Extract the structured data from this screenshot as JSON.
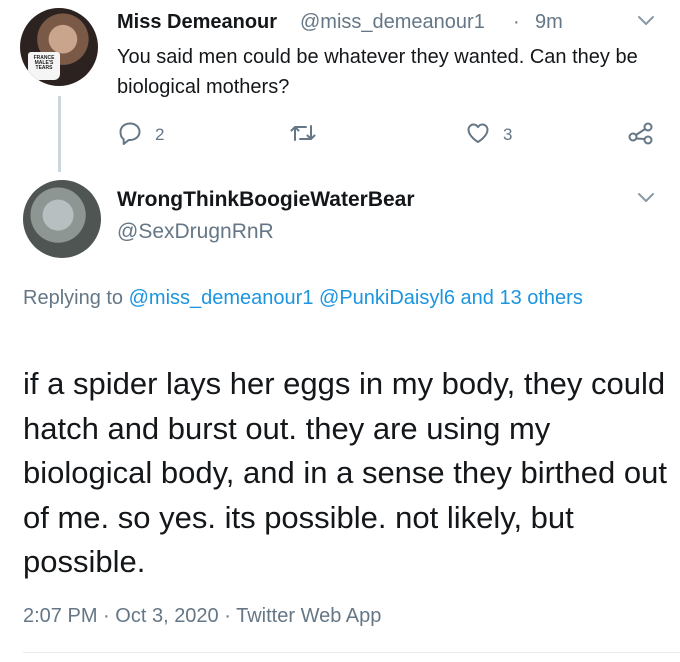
{
  "tweet1": {
    "display_name": "Miss Demeanour",
    "handle": "@miss_demeanour1",
    "separator": "·",
    "time": "9m",
    "text": "You said men could be whatever they wanted. Can they be biological mothers?",
    "avatar_mug_text": "FRANCE MALE'S TEARS",
    "reply_count": "2",
    "retweet_count": "",
    "like_count": "3"
  },
  "tweet2": {
    "display_name": "WrongThinkBoogieWaterBear",
    "handle": "@SexDrugnRnR",
    "replying_prefix": "Replying to",
    "mentions": [
      "@miss_demeanour1",
      "@PunkiDaisyl6",
      "and 13 others"
    ],
    "text": "if a spider lays her eggs in my body, they could hatch and burst out. they are using my biological body, and in a sense they birthed out of me. so yes. its possible. not likely, but possible.",
    "time": "2:07 PM",
    "date": "Oct 3, 2020",
    "source": "Twitter Web App",
    "separator": "·"
  },
  "icons": {
    "more": "chevron-down-icon",
    "reply": "reply-icon",
    "retweet": "retweet-icon",
    "like": "heart-icon",
    "share": "share-icon"
  },
  "colors": {
    "text": "#14171a",
    "secondary": "#657786",
    "link": "#1b95e0",
    "thread_line": "#ccd6dd"
  }
}
